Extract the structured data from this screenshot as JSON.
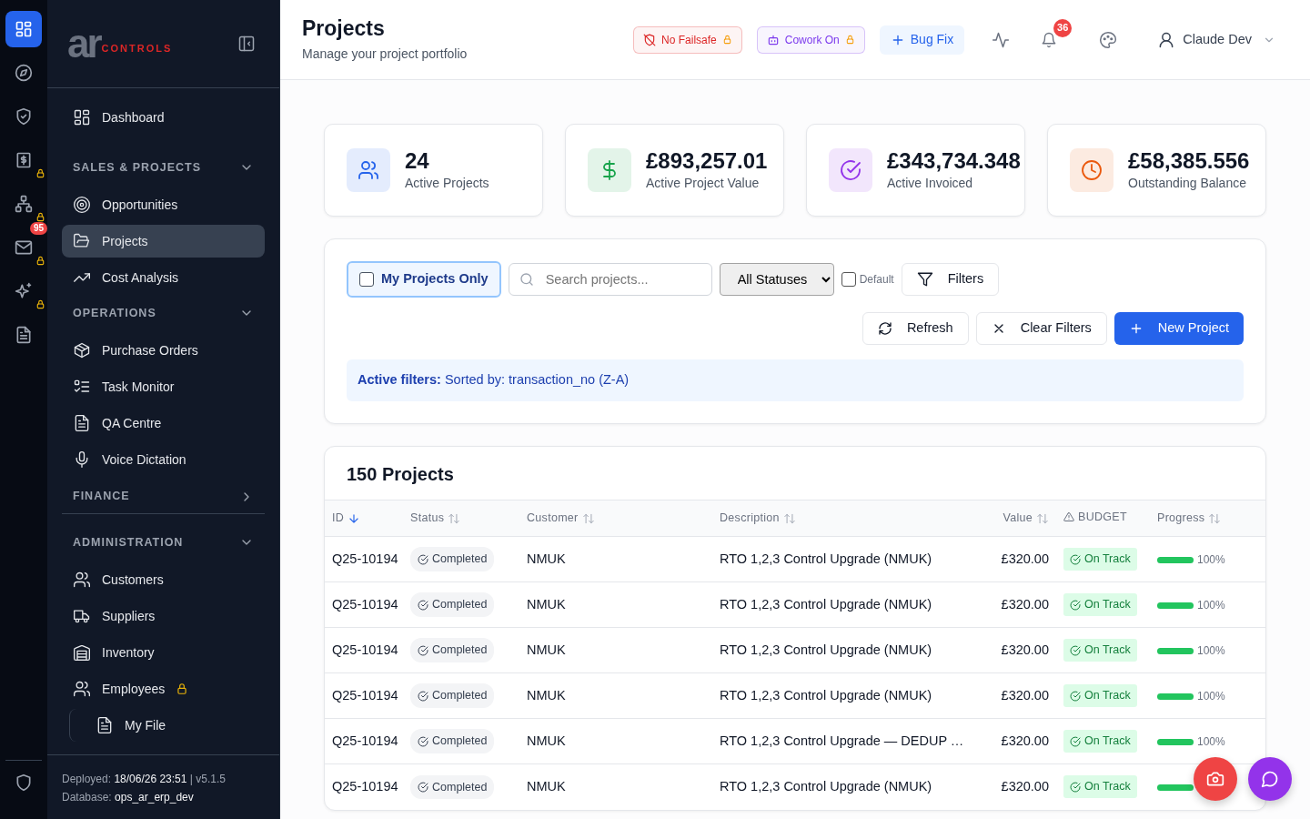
{
  "rail": {
    "items": [
      {
        "selected": true,
        "locked": false
      },
      {
        "selected": false,
        "locked": false
      },
      {
        "selected": false,
        "locked": false
      },
      {
        "selected": false,
        "locked": true
      },
      {
        "selected": false,
        "locked": true
      },
      {
        "selected": false,
        "locked": true,
        "badge": "95"
      },
      {
        "selected": false,
        "locked": true
      },
      {
        "selected": false,
        "locked": false
      }
    ]
  },
  "sidebar": {
    "logo": {
      "mark": "ar",
      "text": "CONTROLS"
    },
    "items": [
      {
        "kind": "item",
        "label": "Dashboard",
        "selected": false
      },
      {
        "kind": "section",
        "label": "SALES & PROJECTS",
        "expanded": true
      },
      {
        "kind": "item",
        "label": "Opportunities",
        "selected": false
      },
      {
        "kind": "item",
        "label": "Projects",
        "selected": true
      },
      {
        "kind": "item",
        "label": "Cost Analysis",
        "selected": false
      },
      {
        "kind": "section",
        "label": "OPERATIONS",
        "expanded": true
      },
      {
        "kind": "item",
        "label": "Purchase Orders",
        "selected": false
      },
      {
        "kind": "item",
        "label": "Task Monitor",
        "selected": false
      },
      {
        "kind": "item",
        "label": "QA Centre",
        "selected": false
      },
      {
        "kind": "item",
        "label": "Voice Dictation",
        "selected": false
      },
      {
        "kind": "section",
        "label": "FINANCE",
        "expanded": false
      },
      {
        "kind": "section",
        "label": "ADMINISTRATION",
        "expanded": true
      },
      {
        "kind": "item",
        "label": "Customers",
        "selected": false
      },
      {
        "kind": "item",
        "label": "Suppliers",
        "selected": false
      },
      {
        "kind": "item",
        "label": "Inventory",
        "selected": false
      },
      {
        "kind": "item",
        "label": "Employees",
        "selected": false,
        "locked": true,
        "children": [
          {
            "kind": "item",
            "label": "My File",
            "selected": false
          }
        ]
      }
    ],
    "footer": {
      "deployed_label": "Deployed:",
      "deployed": "18/06/26 23:51",
      "separator": "|",
      "version": "v5.1.5",
      "database_label": "Database:",
      "database": "ops_ar_erp_dev"
    }
  },
  "header": {
    "title": "Projects",
    "subtitle": "Manage your project portfolio",
    "toggles": [
      {
        "label": "No Failsafe",
        "color": "#dc2626",
        "locked": true
      },
      {
        "label": "Cowork On",
        "color": "#7c3aed",
        "locked": true
      }
    ],
    "action": "Bug Fix",
    "notifications": "36",
    "user": "Claude Dev"
  },
  "stats": [
    {
      "value": "24",
      "label": "Active Projects",
      "color": "#2563eb"
    },
    {
      "value": "£893,257.01",
      "label": "Active Project Value",
      "color": "#16a34a"
    },
    {
      "value": "£343,734.348",
      "label": "Active Invoiced",
      "color": "#9333ea"
    },
    {
      "value": "£58,385.556",
      "label": "Outstanding Balance",
      "color": "#ea580c"
    }
  ],
  "filters": {
    "my_projects": {
      "label": "My Projects Only",
      "checked": false
    },
    "search": {
      "placeholder": "Search projects..."
    },
    "status": "All Statuses",
    "default": {
      "label": "Default",
      "checked": false
    },
    "filters_button": "Filters",
    "refresh": "Refresh",
    "clear": "Clear Filters",
    "new": "New Project",
    "active": "**Active filters:** Sorted by: transaction_no (Z-A)"
  },
  "table": {
    "title": "150 Projects",
    "columns": [
      {
        "label": "ID",
        "sortable": true,
        "sorted": true
      },
      {
        "label": "Status",
        "sortable": true,
        "sorted": false
      },
      {
        "label": "Customer",
        "sortable": true,
        "sorted": false
      },
      {
        "label": "Description",
        "sortable": true,
        "sorted": false
      },
      {
        "label": "Value",
        "sortable": true,
        "sorted": false
      },
      {
        "label": "BUDGET",
        "sortable": false
      },
      {
        "label": "Progress",
        "sortable": true,
        "sorted": false
      }
    ],
    "rows": [
      {
        "id": "Q25-10194",
        "status": "Completed",
        "customer": "NMUK",
        "description": "RTO 1,2,3 Control Upgrade (NMUK)",
        "value": "£320.00",
        "budget": "On Track",
        "level": 1,
        "reading": "100%"
      },
      {
        "id": "Q25-10194",
        "status": "Completed",
        "customer": "NMUK",
        "description": "RTO 1,2,3 Control Upgrade (NMUK)",
        "value": "£320.00",
        "budget": "On Track",
        "level": 1,
        "reading": "100%"
      },
      {
        "id": "Q25-10194",
        "status": "Completed",
        "customer": "NMUK",
        "description": "RTO 1,2,3 Control Upgrade (NMUK)",
        "value": "£320.00",
        "budget": "On Track",
        "level": 1,
        "reading": "100%"
      },
      {
        "id": "Q25-10194",
        "status": "Completed",
        "customer": "NMUK",
        "description": "RTO 1,2,3 Control Upgrade (NMUK)",
        "value": "£320.00",
        "budget": "On Track",
        "level": 1,
        "reading": "100%"
      },
      {
        "id": "Q25-10194",
        "status": "Completed",
        "customer": "NMUK",
        "description": "RTO 1,2,3 Control Upgrade — DEDUP …",
        "value": "£320.00",
        "budget": "On Track",
        "level": 1,
        "reading": "100%"
      },
      {
        "id": "Q25-10194",
        "status": "Completed",
        "customer": "NMUK",
        "description": "RTO 1,2,3 Control Upgrade (NMUK)",
        "value": "£320.00",
        "budget": "On Track",
        "level": 1
      }
    ]
  },
  "fabs": [
    {
      "color": "#ef4444"
    },
    {
      "color": "#9333ea"
    }
  ]
}
